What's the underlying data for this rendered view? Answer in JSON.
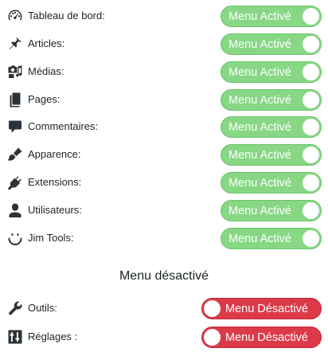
{
  "active_menus": [
    {
      "icon": "dashboard-icon",
      "label": "Tableau de bord:",
      "toggle_label": "Menu Activé",
      "enabled": true
    },
    {
      "icon": "pushpin-icon",
      "label": "Articles:",
      "toggle_label": "Menu Activé",
      "enabled": true
    },
    {
      "icon": "media-icon",
      "label": "Médias:",
      "toggle_label": "Menu Activé",
      "enabled": true
    },
    {
      "icon": "pages-icon",
      "label": "Pages:",
      "toggle_label": "Menu Activé",
      "enabled": true
    },
    {
      "icon": "comment-icon",
      "label": "Commentaires:",
      "toggle_label": "Menu Activé",
      "enabled": true
    },
    {
      "icon": "paintbrush-icon",
      "label": "Apparence:",
      "toggle_label": "Menu Activé",
      "enabled": true
    },
    {
      "icon": "plugin-icon",
      "label": "Extensions:",
      "toggle_label": "Menu Activé",
      "enabled": true
    },
    {
      "icon": "user-icon",
      "label": "Utilisateurs:",
      "toggle_label": "Menu Activé",
      "enabled": true
    },
    {
      "icon": "smile-icon",
      "label": "Jim Tools:",
      "toggle_label": "Menu Activé",
      "enabled": true
    }
  ],
  "disabled_section": {
    "heading": "Menu désactivé"
  },
  "disabled_menus": [
    {
      "icon": "wrench-icon",
      "label": "Outils:",
      "toggle_label": "Menu Désactivé",
      "enabled": false
    },
    {
      "icon": "settings-sliders-icon",
      "label": "Réglages :",
      "toggle_label": "Menu Désactivé",
      "enabled": false
    }
  ],
  "colors": {
    "active_toggle": "#87d785",
    "inactive_toggle": "#dc3a47",
    "icon": "#2c3338",
    "text": "#1d2327"
  }
}
